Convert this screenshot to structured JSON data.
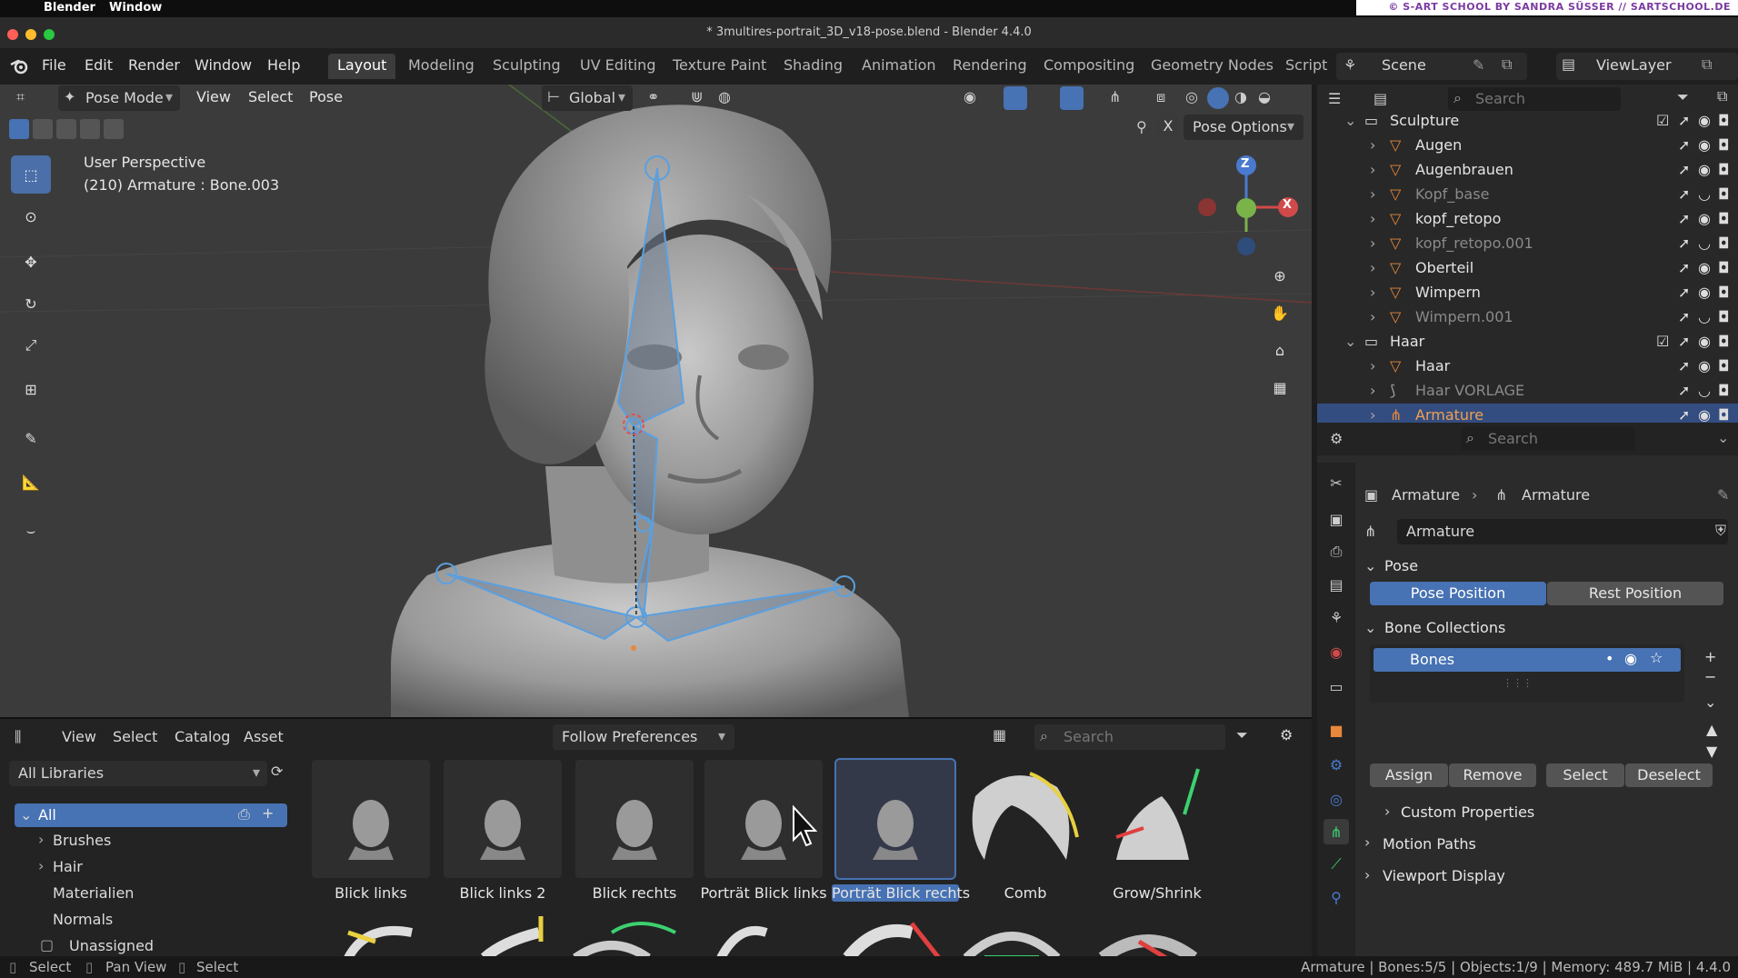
{
  "macbar": {
    "apple": "",
    "menu": [
      "Blender",
      "Window"
    ],
    "credit": "© S-ART SCHOOL BY SANDRA SÜSSER // SARTSCHOOL.DE"
  },
  "titlebar": {
    "title": "* 3multires-portrait_3D_v18-pose.blend - Blender 4.4.0"
  },
  "menu": [
    "File",
    "Edit",
    "Render",
    "Window",
    "Help"
  ],
  "workspaces": [
    "Layout",
    "Modeling",
    "Sculpting",
    "UV Editing",
    "Texture Paint",
    "Shading",
    "Animation",
    "Rendering",
    "Compositing",
    "Geometry Nodes",
    "Script"
  ],
  "active_workspace": "Layout",
  "scene": {
    "label": "Scene",
    "viewlayer": "ViewLayer"
  },
  "viewport": {
    "mode": "Pose Mode",
    "menus": [
      "View",
      "Select",
      "Pose"
    ],
    "orientation": "Global",
    "perspective": "User Perspective",
    "object_info": "(210) Armature : Bone.003",
    "pose_options": "Pose Options",
    "x_label": "X",
    "gizmo": {
      "z": "Z",
      "x": "X"
    }
  },
  "asset_browser": {
    "menus": [
      "View",
      "Select",
      "Catalog",
      "Asset"
    ],
    "import_method": "Follow Preferences",
    "search_placeholder": "Search",
    "library": "All Libraries",
    "catalog_tree": [
      {
        "label": "All",
        "expanded": true,
        "selected": true
      },
      {
        "label": "Brushes",
        "expandable": true
      },
      {
        "label": "Hair",
        "expandable": true
      },
      {
        "label": "Materialien"
      },
      {
        "label": "Normals"
      },
      {
        "label": "Unassigned"
      }
    ],
    "assets": [
      {
        "label": "Blick links"
      },
      {
        "label": "Blick links 2"
      },
      {
        "label": "Blick rechts"
      },
      {
        "label": "Porträt Blick links"
      },
      {
        "label": "Porträt Blick rechts",
        "selected": true
      },
      {
        "label": "Comb"
      },
      {
        "label": "Grow/Shrink"
      }
    ]
  },
  "outliner": {
    "search_placeholder": "Search",
    "rows": [
      {
        "name": "Sculpture",
        "type": "collection"
      },
      {
        "name": "Augen",
        "type": "mesh"
      },
      {
        "name": "Augenbrauen",
        "type": "mesh"
      },
      {
        "name": "Kopf_base",
        "type": "mesh",
        "hidden": true
      },
      {
        "name": "kopf_retopo",
        "type": "mesh"
      },
      {
        "name": "kopf_retopo.001",
        "type": "mesh",
        "hidden": true
      },
      {
        "name": "Oberteil",
        "type": "mesh"
      },
      {
        "name": "Wimpern",
        "type": "mesh"
      },
      {
        "name": "Wimpern.001",
        "type": "mesh",
        "hidden": true
      },
      {
        "name": "Haar",
        "type": "collection"
      },
      {
        "name": "Haar",
        "type": "mesh"
      },
      {
        "name": "Haar VORLAGE",
        "type": "curve",
        "hidden": true
      },
      {
        "name": "Armature",
        "type": "armature",
        "selected": true
      }
    ]
  },
  "properties": {
    "search_placeholder": "Search",
    "breadcrumb": [
      "Armature",
      "Armature"
    ],
    "data_name": "Armature",
    "pose_section": "Pose",
    "pose_position": "Pose Position",
    "rest_position": "Rest Position",
    "bone_collections": "Bone Collections",
    "collection_item": "Bones",
    "assign": "Assign",
    "remove": "Remove",
    "select": "Select",
    "deselect": "Deselect",
    "custom_properties": "Custom Properties",
    "motion_paths": "Motion Paths",
    "viewport_display": "Viewport Display"
  },
  "status": {
    "left": [
      "Select",
      "Pan View",
      "Select"
    ],
    "right": "Armature | Bones:5/5 | Objects:1/9 | Memory: 489.7 MiB | 4.4.0"
  },
  "colors": {
    "accent": "#4772b3",
    "orange": "#e8883a",
    "viewport_bg": "#3b3b3b",
    "bone": "#5aa0e0"
  }
}
